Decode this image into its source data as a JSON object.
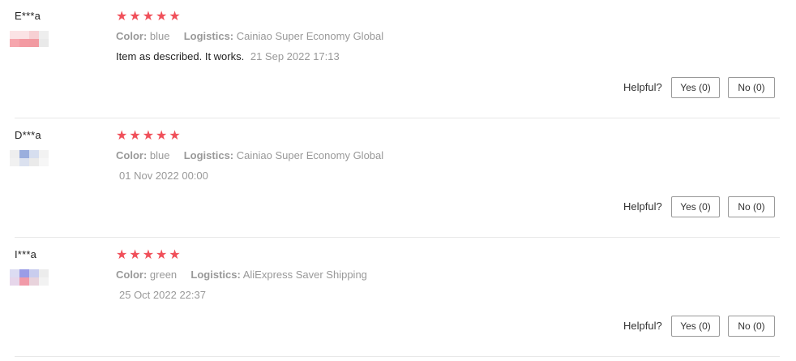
{
  "colors": {
    "star": "#f0505a",
    "muted_text": "#999999",
    "button_border": "#999999"
  },
  "icons": {
    "star": "star-icon",
    "flag": "country-flag-icon"
  },
  "reviews": [
    {
      "username": "E***a",
      "rating": 5,
      "color_label": "Color:",
      "color_value": "blue",
      "logistics_label": "Logistics:",
      "logistics_value": "Cainiao Super Economy Global",
      "text": "Item as described. It works.",
      "date": "21 Sep 2022 17:13",
      "helpful_label": "Helpful?",
      "yes_label": "Yes (0)",
      "no_label": "No (0)"
    },
    {
      "username": "D***a",
      "rating": 5,
      "color_label": "Color:",
      "color_value": "blue",
      "logistics_label": "Logistics:",
      "logistics_value": "Cainiao Super Economy Global",
      "text": "",
      "date": "01 Nov 2022 00:00",
      "helpful_label": "Helpful?",
      "yes_label": "Yes (0)",
      "no_label": "No (0)"
    },
    {
      "username": "I***a",
      "rating": 5,
      "color_label": "Color:",
      "color_value": "green",
      "logistics_label": "Logistics:",
      "logistics_value": "AliExpress Saver Shipping",
      "text": "",
      "date": "25 Oct 2022 22:37",
      "helpful_label": "Helpful?",
      "yes_label": "Yes (0)",
      "no_label": "No (0)"
    }
  ]
}
